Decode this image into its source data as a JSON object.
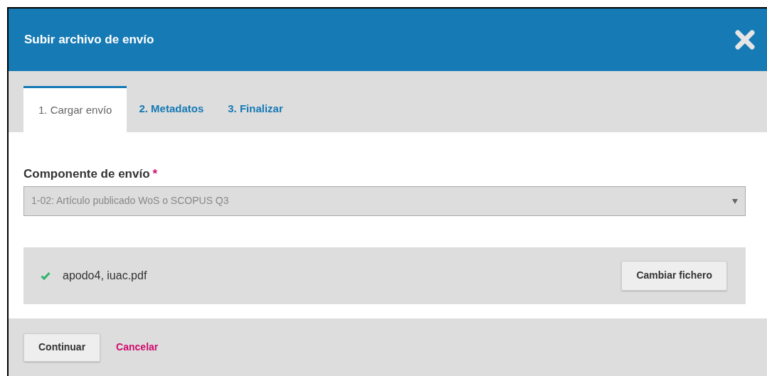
{
  "dialog": {
    "title": "Subir archivo de envío"
  },
  "tabs": [
    {
      "label": "1. Cargar envío",
      "selected": true
    },
    {
      "label": "2. Metadatos",
      "selected": false
    },
    {
      "label": "3. Finalizar",
      "selected": false
    }
  ],
  "component_field": {
    "label": "Componente de envío",
    "required_mark": "*",
    "value": "1-02: Artículo publicado WoS o SCOPUS Q3"
  },
  "uploaded_file": {
    "name": "apodo4, iuac.pdf",
    "button": "Cambiar fichero"
  },
  "footer": {
    "continue_button": "Continuar",
    "cancel_link": "Cancelar"
  }
}
